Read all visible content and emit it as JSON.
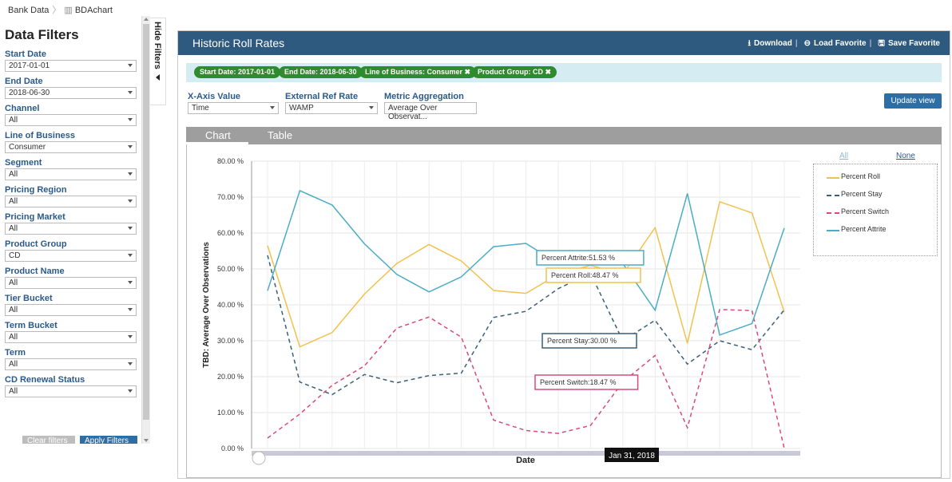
{
  "breadcrumb": {
    "root": "Bank Data",
    "current": "BDAchart"
  },
  "sidebar": {
    "title": "Data Filters",
    "filters": [
      {
        "label": "Start Date",
        "value": "2017-01-01"
      },
      {
        "label": "End Date",
        "value": "2018-06-30"
      },
      {
        "label": "Channel",
        "value": "All"
      },
      {
        "label": "Line of Business",
        "value": "Consumer"
      },
      {
        "label": "Segment",
        "value": "All"
      },
      {
        "label": "Pricing Region",
        "value": "All"
      },
      {
        "label": "Pricing Market",
        "value": "All"
      },
      {
        "label": "Product Group",
        "value": "CD"
      },
      {
        "label": "Product Name",
        "value": "All"
      },
      {
        "label": "Tier Bucket",
        "value": "All"
      },
      {
        "label": "Term Bucket",
        "value": "All"
      },
      {
        "label": "Term",
        "value": "All"
      },
      {
        "label": "CD Renewal Status",
        "value": "All"
      }
    ],
    "clear_label": "Clear filters",
    "apply_label": "Apply Filters",
    "hide_label": "Hide Filters"
  },
  "panel": {
    "title": "Historic Roll Rates",
    "download": "Download",
    "load_favorite": "Load Favorite",
    "save_favorite": "Save Favorite",
    "chips": [
      "Start Date: 2017-01-01",
      "End Date: 2018-06-30",
      "Line of Business: Consumer",
      "Product Group: CD"
    ],
    "xaxis_label": "X-Axis Value",
    "xaxis_value": "Time",
    "extref_label": "External Ref Rate",
    "extref_value": "WAMP",
    "metric_label": "Metric Aggregation",
    "metric_value": "Average Over Observat...",
    "update_label": "Update view",
    "tab_chart": "Chart",
    "tab_table": "Table",
    "legend_all": "All",
    "legend_none": "None"
  },
  "colors": {
    "header": "#2e5a80",
    "chip": "#2e8b2e",
    "roll": "#f2c14e",
    "stay": "#3a5f7a",
    "switch": "#d94a7a",
    "attrite": "#4aacc5"
  },
  "chart_data": {
    "type": "line",
    "xlabel": "Date",
    "ylabel": "TBD: Average Over Observations",
    "ylim": [
      0,
      80
    ],
    "yticks": [
      "0.00 %",
      "10.00 %",
      "20.00 %",
      "30.00 %",
      "40.00 %",
      "50.00 %",
      "60.00 %",
      "70.00 %",
      "80.00 %"
    ],
    "series": [
      {
        "name": "Percent Roll",
        "style": "solid",
        "values": [
          56.5,
          28.3,
          32.3,
          43,
          51.5,
          56.8,
          52.2,
          44,
          43.2,
          48.5,
          51,
          48.5,
          61.5,
          29.3,
          68.7,
          65.6,
          38
        ]
      },
      {
        "name": "Percent Stay",
        "style": "dashed",
        "values": [
          53.8,
          18.5,
          15,
          20.6,
          18.3,
          20.3,
          21,
          36.5,
          38.2,
          44.5,
          48.8,
          30,
          35.7,
          23.5,
          30,
          27.5,
          38.6
        ]
      },
      {
        "name": "Percent Switch",
        "style": "dashed",
        "values": [
          2.9,
          9.6,
          17.6,
          23,
          33.5,
          36.6,
          31,
          7.9,
          5,
          4.2,
          6.4,
          18.5,
          25.9,
          5.8,
          38.7,
          38.4,
          0
        ]
      },
      {
        "name": "Percent Attrite",
        "style": "solid",
        "values": [
          43.9,
          71.8,
          67.8,
          57,
          48.5,
          43.6,
          47.8,
          56.2,
          57.1,
          51.5,
          51.8,
          51.5,
          38.5,
          71,
          31.6,
          34.8,
          61.4
        ]
      }
    ],
    "tooltips": [
      {
        "text": "Percent Attrite:51.53 %",
        "series": 3
      },
      {
        "text": "Percent Roll:48.47 %",
        "series": 0
      },
      {
        "text": "Percent Stay:30.00 %",
        "series": 1
      },
      {
        "text": "Percent Switch:18.47 %",
        "series": 2
      }
    ],
    "hover_date": "Jan 31, 2018",
    "legend_position": "right"
  }
}
